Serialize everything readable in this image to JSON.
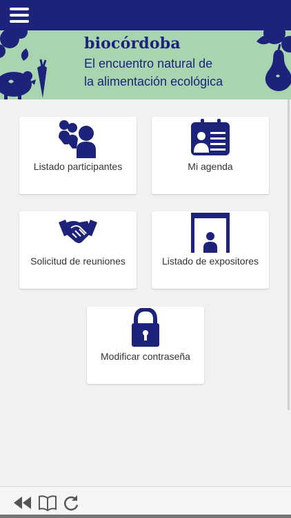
{
  "header": {
    "menu_icon": "hamburger-menu-icon",
    "background_color": "#1d237a"
  },
  "banner": {
    "brand": "biocórdoba",
    "tagline_line1": "El encuentro natural de",
    "tagline_line2": "la alimentación ecológica",
    "background_color": "#a8d5b0"
  },
  "menu": {
    "items": [
      {
        "label": "Listado participantes",
        "icon": "participants-icon"
      },
      {
        "label": "Mi agenda",
        "icon": "agenda-icon"
      },
      {
        "label": "Solicitud de reuniones",
        "icon": "handshake-icon"
      },
      {
        "label": "Listado de expositores",
        "icon": "exhibitor-booth-icon"
      },
      {
        "label": "Modificar contraseña",
        "icon": "lock-icon"
      }
    ],
    "icon_color": "#1d237a"
  },
  "bottom_bar": {
    "buttons": [
      "rewind-icon",
      "book-icon",
      "refresh-icon"
    ]
  }
}
